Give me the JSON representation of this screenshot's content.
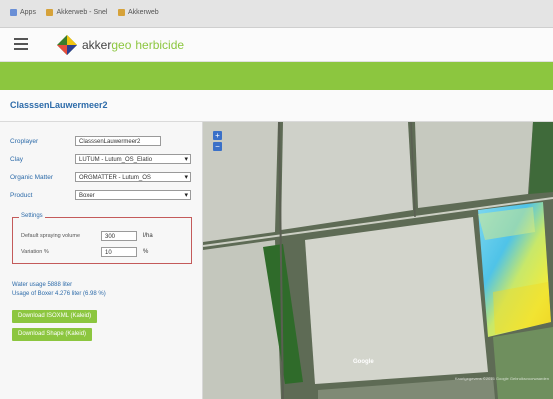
{
  "browser": {
    "bookmarks": [
      {
        "label": "Apps",
        "icon": "apps-grid-icon",
        "color": "#6a8fd6"
      },
      {
        "label": "Akkerweb - Snel",
        "icon": "akkerweb-bookmark-icon",
        "color": "#d6a23a"
      },
      {
        "label": "Akkerweb",
        "icon": "akkerweb-bookmark-icon",
        "color": "#d6a23a"
      }
    ]
  },
  "header": {
    "brand_main": "akker",
    "brand_geo": "geo",
    "module": "herbicide"
  },
  "page": {
    "title": "ClasssenLauwermeer2"
  },
  "form": {
    "croplayer_label": "Croplayer",
    "croplayer_value": "ClasssenLauwermeer2",
    "clay_label": "Clay",
    "clay_value": "LUTUM - Lutum_OS_Elatio",
    "organic_label": "Organic Matter",
    "organic_value": "ORGMATTER - Lutum_OS",
    "product_label": "Product",
    "product_value": "Boxer",
    "section_legend": "Settings",
    "spraying_label": "Default spraying volume",
    "spraying_value": "300",
    "spraying_unit": "l/ha",
    "variation_label": "Variation %",
    "variation_value": "10",
    "variation_unit": "%"
  },
  "summary": {
    "water_usage": "Water usage 5888 liter",
    "product_usage": "Usage of Boxer 4.276 liter (6.98 %)"
  },
  "buttons": {
    "download_isoxml": "Download ISOXML (Kaleid)",
    "download_shape": "Download Shape (Kaleid)"
  },
  "map": {
    "zoom_in": "+",
    "zoom_out": "−",
    "google_label": "Google",
    "attribution": "Kaartgegevens ©2016 Google  Gebruiksvoorwaarden"
  },
  "colors": {
    "accent_green": "#8cc63f",
    "label_blue": "#2d6ba9",
    "zoom_blue": "#3a70c8"
  }
}
